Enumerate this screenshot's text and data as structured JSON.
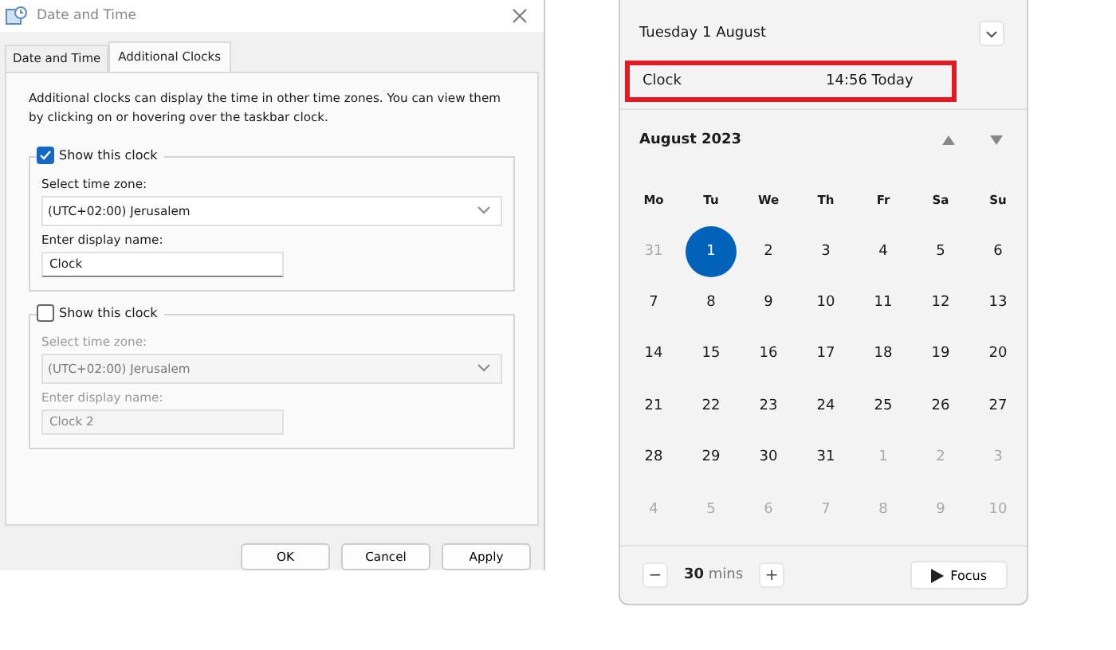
{
  "dialog": {
    "title": "Date and Time",
    "tabs": [
      {
        "label": "Date and Time",
        "selected": false
      },
      {
        "label": "Additional Clocks",
        "selected": true
      }
    ],
    "intro": "Additional clocks can display the time in other time zones. You can view them by clicking on or hovering over the taskbar clock.",
    "clocks": [
      {
        "show_label": "Show this clock",
        "checked": true,
        "disabled": false,
        "zone_label": "Select time zone:",
        "zone": "(UTC+02:00) Jerusalem",
        "name_label": "Enter display name:",
        "name": "Clock"
      },
      {
        "show_label": "Show this clock",
        "checked": false,
        "disabled": true,
        "zone_label": "Select time zone:",
        "zone": "(UTC+02:00) Jerusalem",
        "name_label": "Enter display name:",
        "name": "Clock 2"
      }
    ],
    "buttons": [
      "OK",
      "Cancel",
      "Apply"
    ]
  },
  "calendar": {
    "date": "Tuesday 1 August",
    "clock": {
      "name": "Clock",
      "time": "14:56 Today",
      "highlighted": true
    },
    "month": "August 2023",
    "weekdays": [
      "Mo",
      "Tu",
      "We",
      "Th",
      "Fr",
      "Sa",
      "Su"
    ],
    "weeks": [
      [
        {
          "label": "31",
          "muted": true,
          "selected": false
        },
        {
          "label": "1",
          "muted": false,
          "selected": true
        },
        {
          "label": "2",
          "muted": false,
          "selected": false
        },
        {
          "label": "3",
          "muted": false,
          "selected": false
        },
        {
          "label": "4",
          "muted": false,
          "selected": false
        },
        {
          "label": "5",
          "muted": false,
          "selected": false
        },
        {
          "label": "6",
          "muted": false,
          "selected": false
        }
      ],
      [
        {
          "label": "7",
          "muted": false,
          "selected": false
        },
        {
          "label": "8",
          "muted": false,
          "selected": false
        },
        {
          "label": "9",
          "muted": false,
          "selected": false
        },
        {
          "label": "10",
          "muted": false,
          "selected": false
        },
        {
          "label": "11",
          "muted": false,
          "selected": false
        },
        {
          "label": "12",
          "muted": false,
          "selected": false
        },
        {
          "label": "13",
          "muted": false,
          "selected": false
        }
      ],
      [
        {
          "label": "14",
          "muted": false,
          "selected": false
        },
        {
          "label": "15",
          "muted": false,
          "selected": false
        },
        {
          "label": "16",
          "muted": false,
          "selected": false
        },
        {
          "label": "17",
          "muted": false,
          "selected": false
        },
        {
          "label": "18",
          "muted": false,
          "selected": false
        },
        {
          "label": "19",
          "muted": false,
          "selected": false
        },
        {
          "label": "20",
          "muted": false,
          "selected": false
        }
      ],
      [
        {
          "label": "21",
          "muted": false,
          "selected": false
        },
        {
          "label": "22",
          "muted": false,
          "selected": false
        },
        {
          "label": "23",
          "muted": false,
          "selected": false
        },
        {
          "label": "24",
          "muted": false,
          "selected": false
        },
        {
          "label": "25",
          "muted": false,
          "selected": false
        },
        {
          "label": "26",
          "muted": false,
          "selected": false
        },
        {
          "label": "27",
          "muted": false,
          "selected": false
        }
      ],
      [
        {
          "label": "28",
          "muted": false,
          "selected": false
        },
        {
          "label": "29",
          "muted": false,
          "selected": false
        },
        {
          "label": "30",
          "muted": false,
          "selected": false
        },
        {
          "label": "31",
          "muted": false,
          "selected": false
        },
        {
          "label": "1",
          "muted": true,
          "selected": false
        },
        {
          "label": "2",
          "muted": true,
          "selected": false
        },
        {
          "label": "3",
          "muted": true,
          "selected": false
        }
      ],
      [
        {
          "label": "4",
          "muted": true,
          "selected": false
        },
        {
          "label": "5",
          "muted": true,
          "selected": false
        },
        {
          "label": "6",
          "muted": true,
          "selected": false
        },
        {
          "label": "7",
          "muted": true,
          "selected": false
        },
        {
          "label": "8",
          "muted": true,
          "selected": false
        },
        {
          "label": "9",
          "muted": true,
          "selected": false
        },
        {
          "label": "10",
          "muted": true,
          "selected": false
        }
      ]
    ],
    "focus": {
      "duration": "**30** mins",
      "minus": "−",
      "plus": "+",
      "button": "Focus"
    }
  }
}
